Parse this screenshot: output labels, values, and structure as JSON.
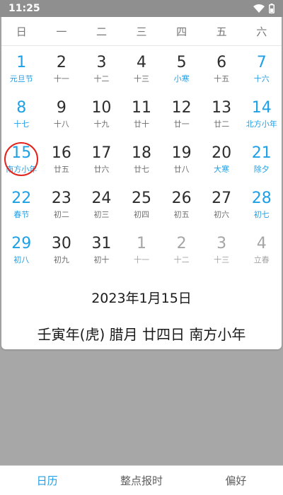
{
  "status_bar": {
    "time": "11:25",
    "icons": [
      "wifi-icon",
      "battery-icon"
    ]
  },
  "calendar": {
    "weekdays": [
      "日",
      "一",
      "二",
      "三",
      "四",
      "五",
      "六"
    ],
    "weeks": [
      [
        {
          "day": "1",
          "lunar": "元旦节",
          "weekend": true,
          "festival": true
        },
        {
          "day": "2",
          "lunar": "十一"
        },
        {
          "day": "3",
          "lunar": "十二"
        },
        {
          "day": "4",
          "lunar": "十三"
        },
        {
          "day": "5",
          "lunar": "小寒",
          "festival": true
        },
        {
          "day": "6",
          "lunar": "十五"
        },
        {
          "day": "7",
          "lunar": "十六",
          "weekend": true
        }
      ],
      [
        {
          "day": "8",
          "lunar": "十七",
          "weekend": true
        },
        {
          "day": "9",
          "lunar": "十八"
        },
        {
          "day": "10",
          "lunar": "十九"
        },
        {
          "day": "11",
          "lunar": "廿十"
        },
        {
          "day": "12",
          "lunar": "廿一"
        },
        {
          "day": "13",
          "lunar": "廿二"
        },
        {
          "day": "14",
          "lunar": "北方小年",
          "weekend": true,
          "festival": true
        }
      ],
      [
        {
          "day": "15",
          "lunar": "南方小年",
          "weekend": true,
          "festival": true,
          "selected": true
        },
        {
          "day": "16",
          "lunar": "廿五"
        },
        {
          "day": "17",
          "lunar": "廿六"
        },
        {
          "day": "18",
          "lunar": "廿七"
        },
        {
          "day": "19",
          "lunar": "廿八"
        },
        {
          "day": "20",
          "lunar": "大寒",
          "festival": true
        },
        {
          "day": "21",
          "lunar": "除夕",
          "weekend": true,
          "festival": true
        }
      ],
      [
        {
          "day": "22",
          "lunar": "春节",
          "weekend": true,
          "festival": true
        },
        {
          "day": "23",
          "lunar": "初二"
        },
        {
          "day": "24",
          "lunar": "初三"
        },
        {
          "day": "25",
          "lunar": "初四"
        },
        {
          "day": "26",
          "lunar": "初五"
        },
        {
          "day": "27",
          "lunar": "初六"
        },
        {
          "day": "28",
          "lunar": "初七",
          "weekend": true
        }
      ],
      [
        {
          "day": "29",
          "lunar": "初八",
          "weekend": true
        },
        {
          "day": "30",
          "lunar": "初九"
        },
        {
          "day": "31",
          "lunar": "初十"
        },
        {
          "day": "1",
          "lunar": "十一",
          "other": true
        },
        {
          "day": "2",
          "lunar": "十二",
          "other": true
        },
        {
          "day": "3",
          "lunar": "十三",
          "other": true
        },
        {
          "day": "4",
          "lunar": "立春",
          "other": true
        }
      ]
    ],
    "selected_date": "2023年1月15日",
    "lunar_date": "壬寅年(虎) 腊月 廿四日 南方小年"
  },
  "bottom_nav": {
    "tabs": [
      {
        "label": "日历",
        "active": true
      },
      {
        "label": "整点报时"
      },
      {
        "label": "偏好"
      }
    ]
  },
  "colors": {
    "accent": "#1fa0e6",
    "selection_ring": "#e2241d",
    "background": "#a7a7a7"
  }
}
